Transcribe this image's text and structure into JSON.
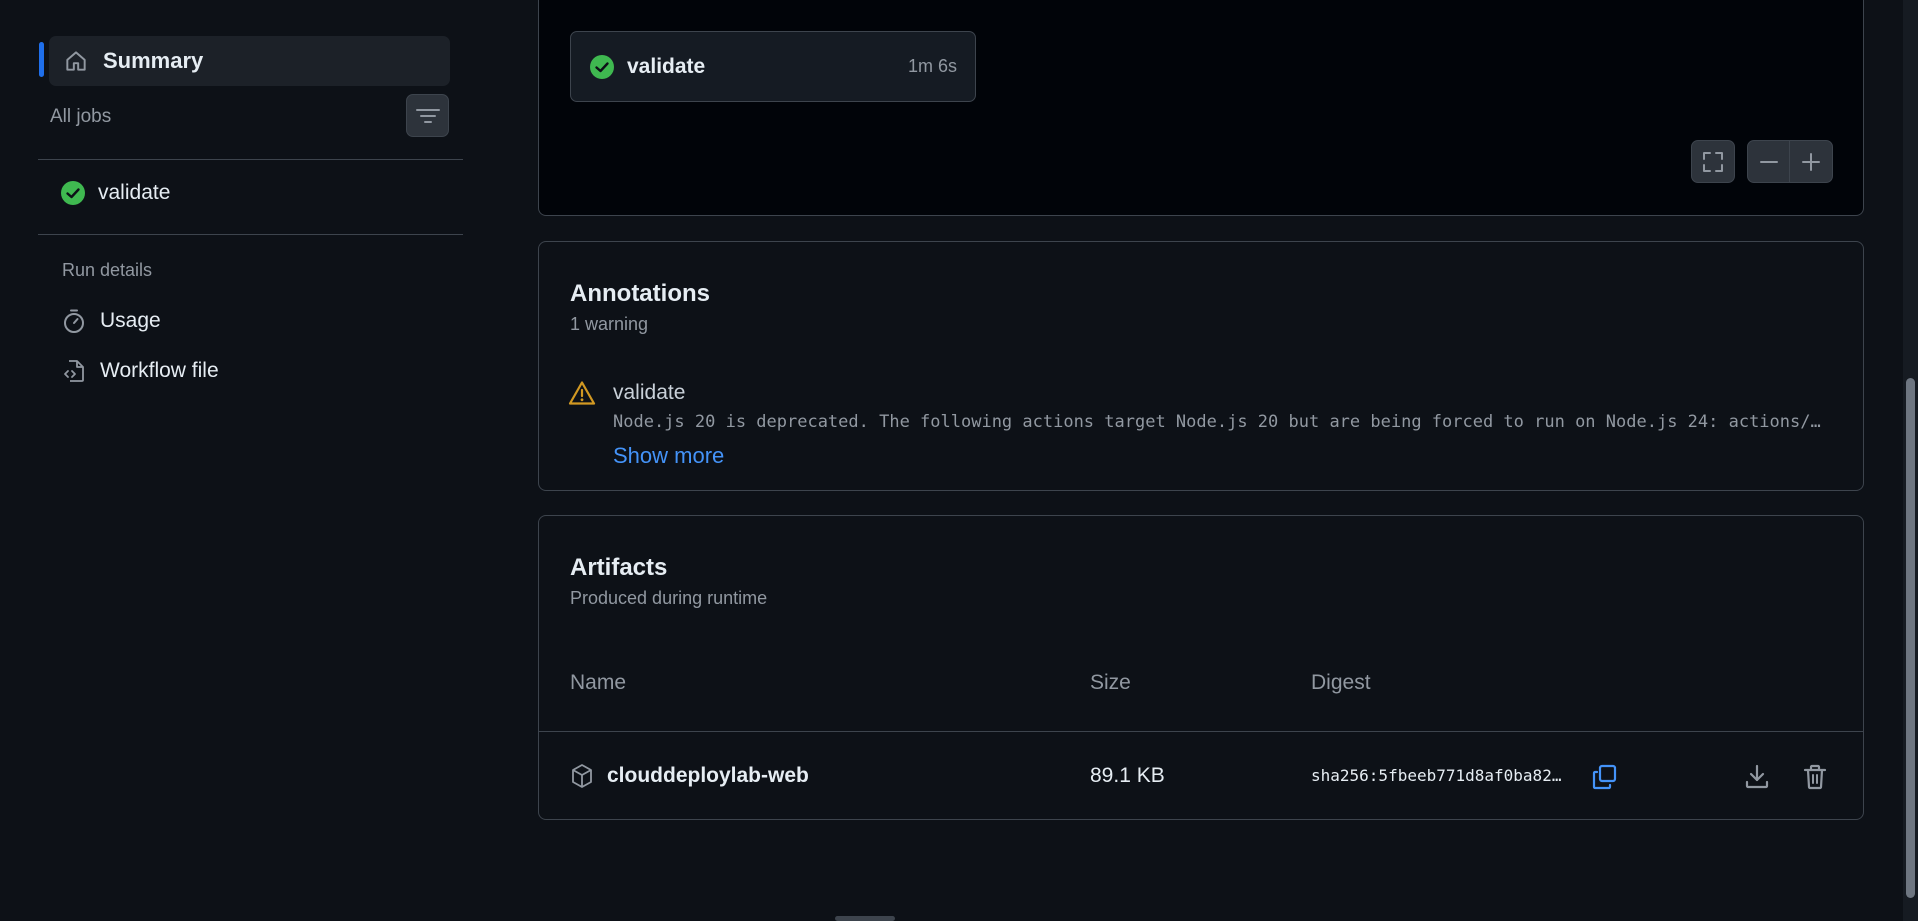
{
  "sidebar": {
    "summary_label": "Summary",
    "all_jobs_label": "All jobs",
    "jobs": [
      {
        "label": "validate",
        "status": "success"
      }
    ],
    "run_details_heading": "Run details",
    "links": [
      {
        "label": "Usage",
        "icon": "stopwatch-icon"
      },
      {
        "label": "Workflow file",
        "icon": "file-code-icon"
      }
    ]
  },
  "graph": {
    "job_name": "validate",
    "job_duration": "1m 6s"
  },
  "annotations": {
    "title": "Annotations",
    "subtitle": "1 warning",
    "items": [
      {
        "job": "validate",
        "level": "warning",
        "message": "Node.js 20 is deprecated. The following actions target Node.js 20 but are being forced to run on Node.js 24: actions/…",
        "show_more_label": "Show more"
      }
    ]
  },
  "artifacts": {
    "title": "Artifacts",
    "subtitle": "Produced during runtime",
    "columns": [
      "Name",
      "Size",
      "Digest"
    ],
    "rows": [
      {
        "name": "clouddeploylab-web",
        "size": "89.1 KB",
        "digest": "sha256:5fbeeb771d8af0ba82…"
      }
    ]
  },
  "colors": {
    "background": "#0d1117",
    "accent": "#1f6feb",
    "success": "#3fb950",
    "warning": "#d29922",
    "link": "#4493f8"
  }
}
